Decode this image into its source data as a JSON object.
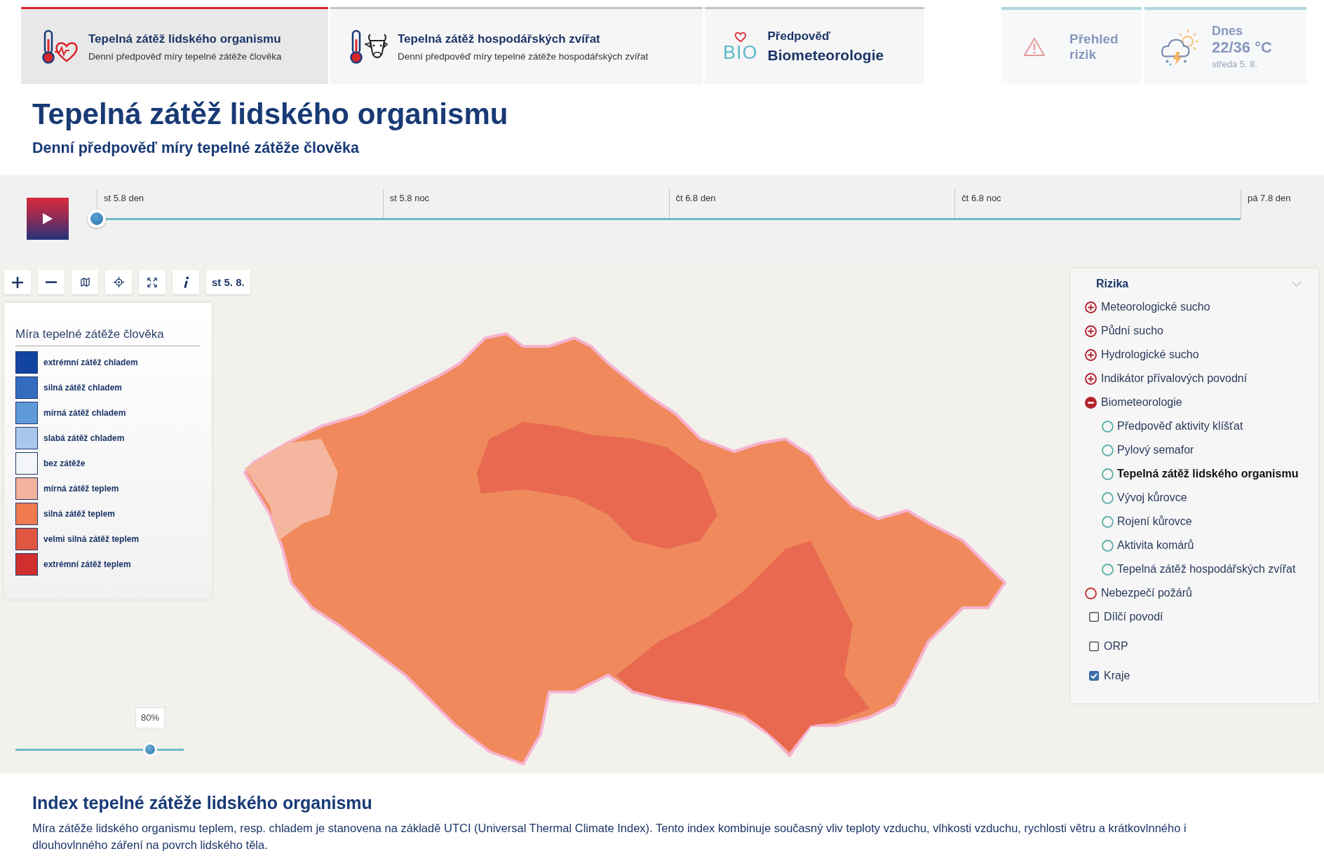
{
  "tabs": [
    {
      "kind": "human",
      "title": "Tepelná zátěž lidského organismu",
      "subtitle": "Denní předpověď míry tepelné zátěže člověka",
      "selected": true
    },
    {
      "kind": "animal",
      "title": "Tepelná zátěž hospodářských zvířat",
      "subtitle": "Denní předpověď míry tepelné zátěže hospodářských zvířat",
      "selected": false
    },
    {
      "kind": "bio",
      "logo": "BIO",
      "title": "Předpověď",
      "subtitle": "Biometeorologie",
      "selected": false
    }
  ],
  "quick_links": [
    {
      "kind": "risks",
      "label": "Přehled rizik"
    },
    {
      "kind": "weather",
      "day": "Dnes",
      "temperature": "22/36 °C",
      "date": "středa 5. 8."
    }
  ],
  "page": {
    "title": "Tepelná zátěž lidského organismu",
    "subtitle": "Denní předpověď míry tepelné zátěže člověka"
  },
  "timeline": {
    "playing": false,
    "labels": [
      "st 5.8 den",
      "st 5.8 noc",
      "čt 6.8 den",
      "čt 6.8 noc",
      "pá 7.8 den"
    ],
    "level": 0
  },
  "map": {
    "toolbar": [
      {
        "kind": "zoom_in"
      },
      {
        "kind": "zoom_out"
      },
      {
        "kind": "basemap"
      },
      {
        "kind": "locate"
      },
      {
        "kind": "fullscreen"
      },
      {
        "kind": "info"
      }
    ],
    "date": "st 5. 8.",
    "legend": {
      "title": "Míra tepelné zátěže člověka",
      "items": [
        {
          "label": "extrémní zátěž chladem",
          "color": "#1245a0"
        },
        {
          "label": "silná zátěž chladem",
          "color": "#356cc0"
        },
        {
          "label": "mírná zátěž chladem",
          "color": "#5f99da"
        },
        {
          "label": "slabá zátěž chladem",
          "color": "#a9c7ea"
        },
        {
          "label": "bez zátěže",
          "color": "#f3f5f8"
        },
        {
          "label": "mírná zátěž teplem",
          "color": "#f2b29b"
        },
        {
          "label": "silná zátěž teplem",
          "color": "#ef7b4f"
        },
        {
          "label": "velmi silná zátěž teplem",
          "color": "#e05640"
        },
        {
          "label": "extrémní zátěž teplem",
          "color": "#d12f2d"
        }
      ]
    },
    "layers": {
      "title": "Rizika",
      "items": [
        {
          "kind": "group",
          "label": "Meteorologické sucho",
          "expanded": false
        },
        {
          "kind": "group",
          "label": "Půdní sucho",
          "expanded": false
        },
        {
          "kind": "group",
          "label": "Hydrologické sucho",
          "expanded": false
        },
        {
          "kind": "group",
          "label": "Indikátor přívalových povodní",
          "expanded": false
        },
        {
          "kind": "group",
          "label": "Biometeorologie",
          "expanded": true,
          "children": [
            {
              "label": "Předpověď aktivity klíšťat",
              "selected": false
            },
            {
              "label": "Pylový semafor",
              "selected": false
            },
            {
              "label": "Tepelná zátěž lidského organismu",
              "selected": true
            },
            {
              "label": "Vývoj kůrovce",
              "selected": false
            },
            {
              "label": "Rojení kůrovce",
              "selected": false
            },
            {
              "label": "Aktivita komárů",
              "selected": false
            },
            {
              "label": "Tepelná zátěž hospodářských zvířat",
              "selected": false
            }
          ]
        },
        {
          "kind": "layer",
          "label": "Nebezpečí požárů",
          "selected": false
        }
      ],
      "overlays": [
        {
          "label": "Dílčí povodí",
          "checked": false
        },
        {
          "label": "ORP",
          "checked": false
        },
        {
          "label": "Kraje",
          "checked": true
        }
      ]
    },
    "opacity": {
      "label": "80%",
      "level": 0.8
    }
  },
  "info": {
    "title": "Index tepelné zátěže lidského organismu",
    "text": "Míra zátěže lidského organismu teplem, resp. chladem je stanovena na základě UTCI (Universal Thermal Climate Index). Tento index kombinuje současný vliv teploty vzduchu, vlhkosti vzduchu, rychlosti větru a krátkovlnného i dlouhovlnného záření na povrch lidského těla."
  }
}
